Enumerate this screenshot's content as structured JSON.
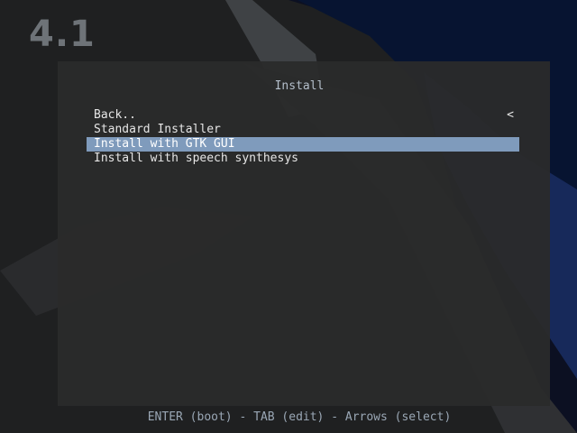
{
  "screen": {
    "version": "4.1"
  },
  "menu": {
    "title": "Install",
    "back_arrow_icon": "chevron-left-icon",
    "items": [
      {
        "label": "Back..",
        "selected": false
      },
      {
        "label": "Standard Installer",
        "selected": false
      },
      {
        "label": "Install with GTK GUI",
        "selected": true
      },
      {
        "label": "Install with speech synthesys",
        "selected": false
      }
    ],
    "back_arrow": "<"
  },
  "help": {
    "text": "ENTER (boot) - TAB (edit) - Arrows (select)"
  },
  "colors": {
    "background": "#202122",
    "panel": "#2b2b2b",
    "selection": "#7f9bbc",
    "title_text": "#b4bfcb",
    "help_text": "#9aa7b5",
    "accent_dark_blue": "#0d1530",
    "logo_text": "#6e7378"
  }
}
